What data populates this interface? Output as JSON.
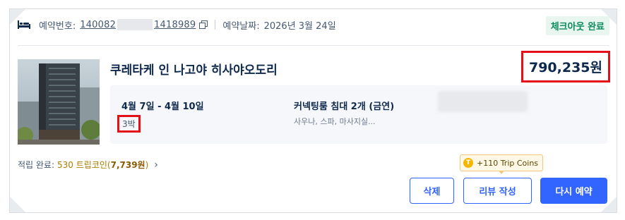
{
  "header": {
    "reservation_label": "예약번호:",
    "reservation_prefix": "140082",
    "reservation_suffix": "1418989",
    "booking_date_label": "예약날짜:",
    "booking_date": "2026년 3월 24일",
    "status": "체크아웃 완료"
  },
  "hotel": {
    "name": "쿠레타케 인 나고야 히사야오도리",
    "price": "790,235원"
  },
  "stay": {
    "dates": "4월 7일 - 4월 10일",
    "nights": "3박",
    "room": "커넥팅룸 침대 2개 (금연)",
    "amenities": "사우나, 스파, 마사지실..."
  },
  "points": {
    "label": "적립 완료:",
    "value": "530 트립코인(",
    "value_bold": "7,739원",
    "value_close": ")"
  },
  "coins_tooltip": "+110 Trip Coins",
  "buttons": {
    "delete": "삭제",
    "review": "리뷰 작성",
    "rebook": "다시 예약"
  },
  "colors": {
    "accent": "#3264ff",
    "status_green": "#0b8a5c",
    "highlight_red": "#e3101a",
    "coin_gold": "#f5b800"
  },
  "icons": {
    "bed": "bed-icon",
    "copy": "copy-icon",
    "chevron": "chevron-right-icon",
    "coin": "trip-coin-icon"
  }
}
